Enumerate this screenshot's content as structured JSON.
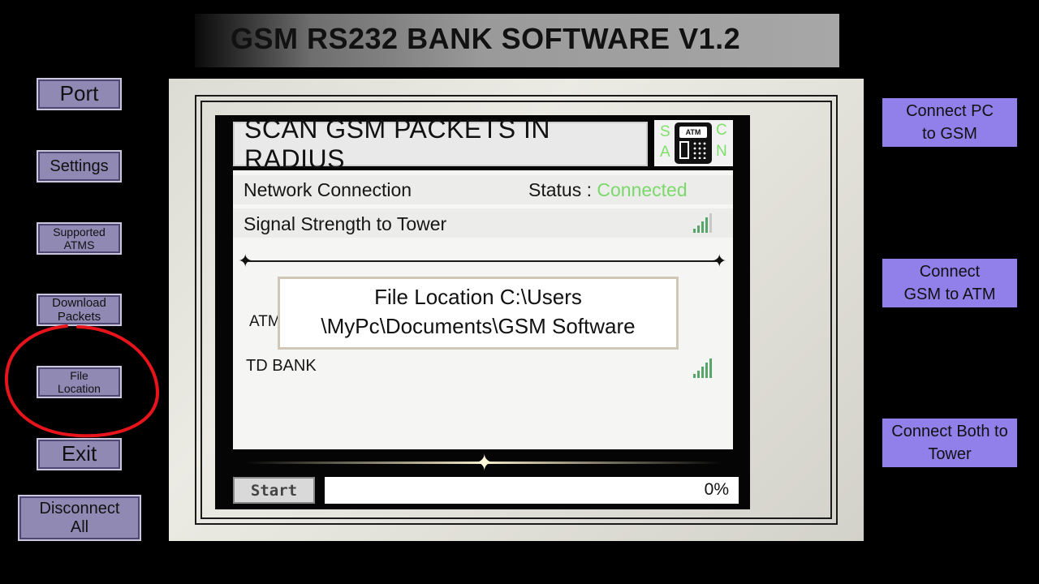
{
  "app": {
    "title": "GSM RS232 BANK SOFTWARE V1.2"
  },
  "sidebar": {
    "port": "Port",
    "settings": "Settings",
    "supported_atms": "Supported ATMS",
    "download_packets": "Download Packets",
    "file_location": "File Location",
    "exit": "Exit",
    "disconnect_all": "Disconnect All"
  },
  "actions": {
    "connect_pc_gsm": "Connect PC to GSM",
    "connect_gsm_atm": "Connect GSM to ATM",
    "connect_both_tower": "Connect Both to Tower"
  },
  "scanner": {
    "header": "SCAN GSM PACKETS IN RADIUS",
    "logo": {
      "s": "S",
      "c": "C",
      "a": "A",
      "n": "N",
      "atm": "ATM"
    },
    "network_label": "Network Connection",
    "status_label": "Status : ",
    "status_value": "Connected",
    "signal_label": "Signal Strength to Tower",
    "atm_partial": "ATM",
    "bank_name": "TD BANK",
    "popup_line1": "File Location C:\\Users",
    "popup_line2": "\\MyPc\\Documents\\GSM Software"
  },
  "controls": {
    "start_label": "Start",
    "progress_label": "0%",
    "progress_value": 0
  },
  "icons": {
    "signal": "signal-bars-icon",
    "atm": "atm-machine-icon",
    "sparkle": "sparkle-star-icon"
  },
  "colors": {
    "side_button": "#8f89b3",
    "action_button": "#9180ea",
    "status_connected": "#7bd86b",
    "signal_bars": "#56a56a",
    "annotation": "#e8141b"
  }
}
